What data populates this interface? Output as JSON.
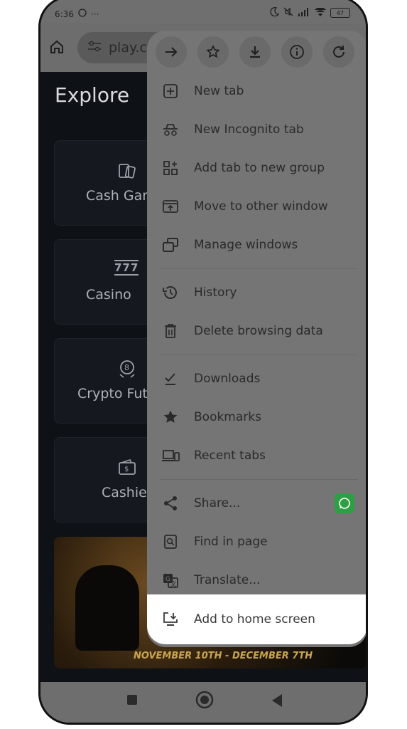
{
  "status": {
    "time": "6:36",
    "battery": "47"
  },
  "url": {
    "text": "play.co"
  },
  "page": {
    "title": "Explore",
    "cards": [
      {
        "label": "Cash Gan",
        "icon": "cards-icon"
      },
      {
        "label": "Casino",
        "icon": "slot-777-icon"
      },
      {
        "label": "Crypto Fut",
        "icon": "crypto-coin-icon"
      },
      {
        "label": "Cashie",
        "icon": "wallet-icon"
      }
    ],
    "banner_text": "NOVEMBER 10TH - DECEMBER 7TH"
  },
  "menu": {
    "top_actions": [
      "forward-icon",
      "bookmark-star-icon",
      "download-icon",
      "info-icon",
      "reload-icon"
    ],
    "items": [
      {
        "label": "New tab",
        "icon": "new-tab-icon"
      },
      {
        "label": "New Incognito tab",
        "icon": "incognito-icon"
      },
      {
        "label": "Add tab to new group",
        "icon": "tab-group-icon"
      },
      {
        "label": "Move to other window",
        "icon": "move-window-icon"
      },
      {
        "label": "Manage windows",
        "icon": "manage-windows-icon"
      },
      {
        "label": "History",
        "icon": "history-icon"
      },
      {
        "label": "Delete browsing data",
        "icon": "trash-icon"
      },
      {
        "label": "Downloads",
        "icon": "downloads-icon"
      },
      {
        "label": "Bookmarks",
        "icon": "star-icon"
      },
      {
        "label": "Recent tabs",
        "icon": "recent-tabs-icon"
      },
      {
        "label": "Share...",
        "icon": "share-icon"
      },
      {
        "label": "Find in page",
        "icon": "find-in-page-icon"
      },
      {
        "label": "Translate...",
        "icon": "translate-icon"
      },
      {
        "label": "Add to home screen",
        "icon": "add-to-home-icon"
      }
    ]
  }
}
